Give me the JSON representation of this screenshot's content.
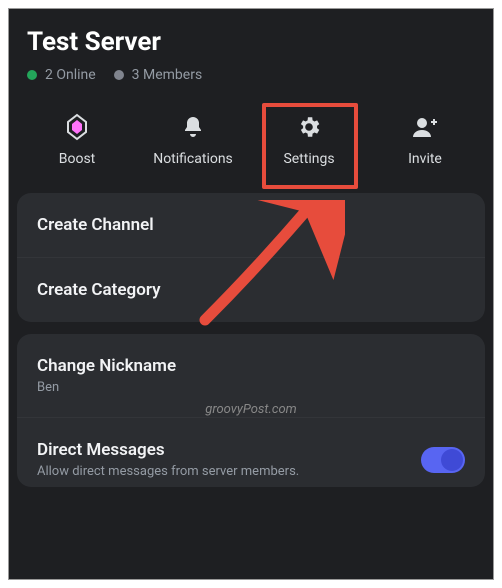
{
  "header": {
    "server_name": "Test Server",
    "online_count": "2 Online",
    "members_count": "3 Members"
  },
  "actions": {
    "boost": "Boost",
    "notifications": "Notifications",
    "settings": "Settings",
    "invite": "Invite"
  },
  "menu": {
    "create_channel": "Create Channel",
    "create_category": "Create Category",
    "change_nickname": "Change Nickname",
    "nickname_value": "Ben",
    "direct_messages": "Direct Messages",
    "dm_description": "Allow direct messages from server members."
  },
  "watermark": "groovyPost.com"
}
